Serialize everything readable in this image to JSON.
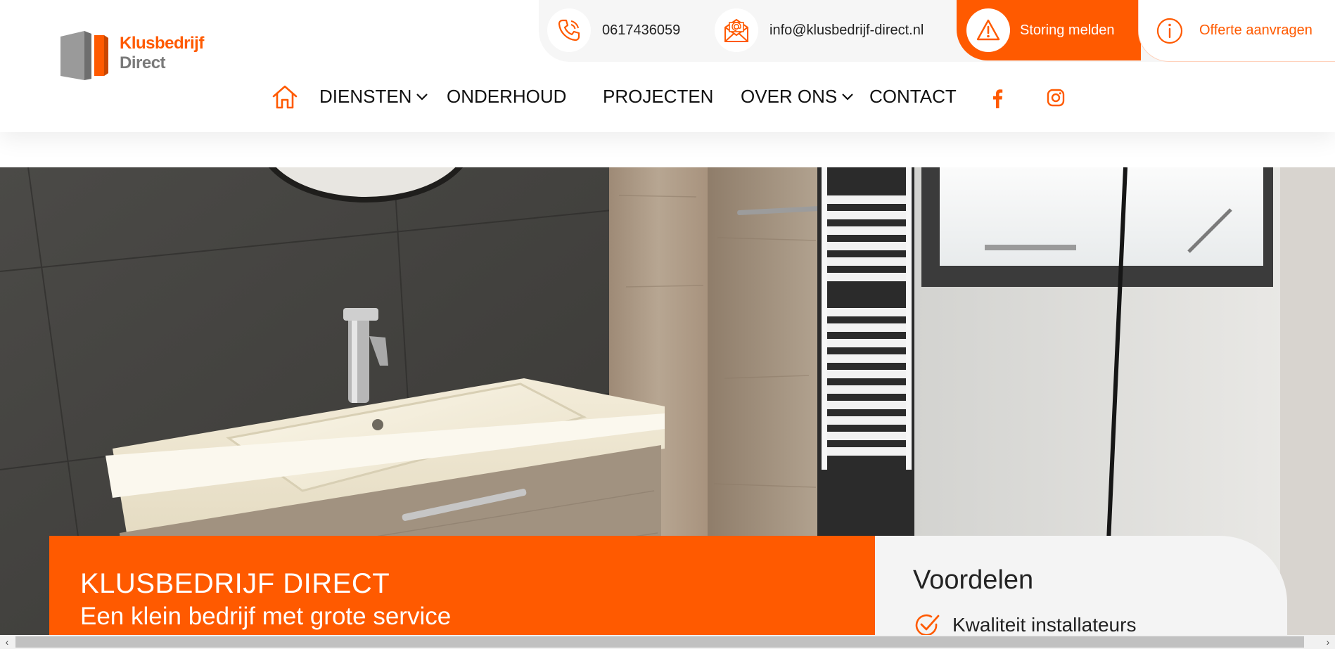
{
  "brand": {
    "logo_line1": "Klusbedrijf",
    "logo_line2": "Direct",
    "accent_color": "#ff5a00"
  },
  "contact_bar": {
    "phone": {
      "icon": "phone-icon",
      "text": "0617436059"
    },
    "email": {
      "icon": "mail-icon",
      "text": "info@klusbedrijf-direct.nl"
    },
    "storing": {
      "icon": "warning-icon",
      "label": "Storing melden"
    },
    "offerte": {
      "icon": "info-icon",
      "label": "Offerte aanvragen"
    }
  },
  "nav": {
    "home_icon": "home-icon",
    "items": [
      {
        "label": "DIENSTEN",
        "dropdown": true
      },
      {
        "label": "ONDERHOUD",
        "dropdown": false
      },
      {
        "label": "PROJECTEN",
        "dropdown": false
      },
      {
        "label": "OVER ONS",
        "dropdown": true
      },
      {
        "label": "CONTACT",
        "dropdown": false
      }
    ],
    "social": [
      "facebook-icon",
      "instagram-icon"
    ]
  },
  "hero": {
    "image": "bathroom-photo",
    "title": "KLUSBEDRIJF DIRECT",
    "subtitle": "Een klein bedrijf met grote service"
  },
  "voordelen": {
    "title": "Voordelen",
    "items": [
      "Kwaliteit installateurs"
    ]
  }
}
